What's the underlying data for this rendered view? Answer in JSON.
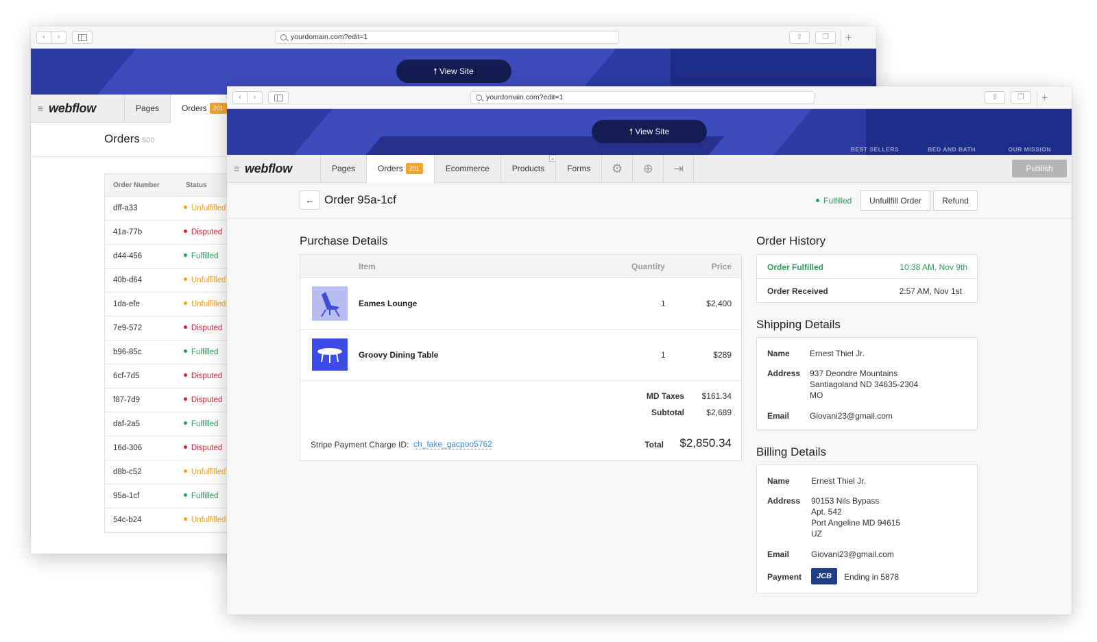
{
  "browser": {
    "url": "yourdomain.com?edit=1",
    "back_icon": "chevron-left",
    "forward_icon": "chevron-right",
    "plus": "+"
  },
  "hero": {
    "view_site": "View Site",
    "nav": [
      "BEST SELLERS",
      "BED AND BATH",
      "OUR MISSION"
    ]
  },
  "topbar": {
    "logo": "webflow",
    "tabs": [
      "Pages",
      "Orders",
      "Ecommerce",
      "Products",
      "Forms"
    ],
    "orders_badge": "201",
    "publish": "Publish",
    "close": "×"
  },
  "orders_list": {
    "title": "Orders",
    "count": "500",
    "columns": [
      "Order Number",
      "Status"
    ],
    "rows": [
      {
        "number": "dff-a33",
        "status": "Unfulfilled"
      },
      {
        "number": "41a-77b",
        "status": "Disputed"
      },
      {
        "number": "d44-456",
        "status": "Fulfilled"
      },
      {
        "number": "40b-d64",
        "status": "Unfulfilled"
      },
      {
        "number": "1da-efe",
        "status": "Unfulfilled"
      },
      {
        "number": "7e9-572",
        "status": "Disputed"
      },
      {
        "number": "b96-85c",
        "status": "Fulfilled"
      },
      {
        "number": "6cf-7d5",
        "status": "Disputed"
      },
      {
        "number": "f87-7d9",
        "status": "Disputed"
      },
      {
        "number": "daf-2a5",
        "status": "Fulfilled"
      },
      {
        "number": "16d-306",
        "status": "Disputed"
      },
      {
        "number": "d8b-c52",
        "status": "Unfulfilled"
      },
      {
        "number": "95a-1cf",
        "status": "Fulfilled"
      },
      {
        "number": "54c-b24",
        "status": "Unfulfilled"
      }
    ],
    "status_colors": {
      "Unfulfilled": "#f0a21d",
      "Disputed": "#c8283c",
      "Fulfilled": "#2a9d5a"
    }
  },
  "order": {
    "title": "Order 95a-1cf",
    "status": "Fulfilled",
    "unfulfill": "Unfullfill Order",
    "refund": "Refund"
  },
  "purchase": {
    "heading": "Purchase Details",
    "col_item": "Item",
    "col_qty": "Quantity",
    "col_price": "Price",
    "items": [
      {
        "name": "Eames Lounge",
        "qty": "1",
        "price": "$2,400"
      },
      {
        "name": "Groovy Dining Table",
        "qty": "1",
        "price": "$289"
      }
    ],
    "tax_label": "MD Taxes",
    "tax": "$161.34",
    "subtotal_label": "Subtotal",
    "subtotal": "$2,689",
    "stripe_label": "Stripe Payment Charge ID:",
    "stripe_id": "ch_fake_gacpoo5762",
    "total_label": "Total",
    "total": "$2,850.34"
  },
  "history": {
    "heading": "Order History",
    "rows": [
      {
        "label": "Order Fulfilled",
        "time": "10:38 AM, Nov 9th"
      },
      {
        "label": "Order Received",
        "time": "2:57 AM, Nov 1st"
      }
    ]
  },
  "shipping": {
    "heading": "Shipping Details",
    "name_label": "Name",
    "name": "Ernest Thiel Jr.",
    "address_label": "Address",
    "address": [
      "937 Deondre Mountains",
      "Santiagoland ND 34635-2304",
      "MO"
    ],
    "email_label": "Email",
    "email": "Giovani23@gmail.com"
  },
  "billing": {
    "heading": "Billing Details",
    "name_label": "Name",
    "name": "Ernest Thiel Jr.",
    "address_label": "Address",
    "address": [
      "90153 Nils Bypass",
      "Apt. 542",
      "Port Angeline MD 94615",
      "UZ"
    ],
    "email_label": "Email",
    "email": "Giovani23@gmail.com",
    "payment_label": "Payment",
    "card_brand": "JCB",
    "card_ending": "Ending in 5878"
  },
  "colors": {
    "accent_green": "#2a9d5a",
    "badge_orange": "#f1a430",
    "hero_blue": "#2d3aa3"
  }
}
